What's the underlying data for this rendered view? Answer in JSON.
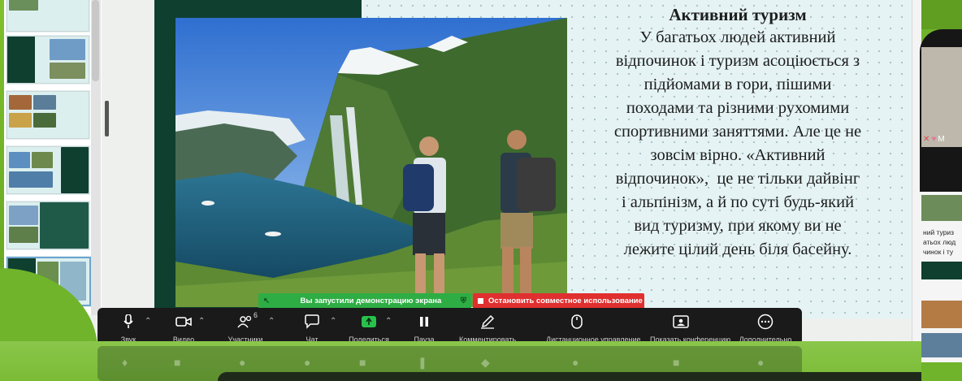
{
  "slide": {
    "title": "Активний туризм",
    "body_lines": [
      "У багатьох людей активний",
      "відпочинок і туризм асоціюється з",
      "підйомами в гори, пішими",
      "походами та різними рухомими",
      "спортивними заняттями. Але це не",
      "зовсім вірно. «Активний",
      "відпочинок»,  це не тільки дайвінг",
      "і альпінізм, а й по суті будь-який",
      "вид туризму, при якому ви не",
      "лежите цілий день біля басейну."
    ]
  },
  "banners": {
    "sharing": "Вы запустили демонстрацию экрана",
    "stop": "Остановить совместное использование"
  },
  "toolbar": {
    "sound": "Звук",
    "video": "Видео",
    "participants": "Участники",
    "participants_count": "6",
    "chat": "Чат",
    "share": "Поделиться",
    "pause": "Пауза",
    "annotate": "Комментировать",
    "remote_control": "Дистанционное управление",
    "show_conference": "Показать конференцию",
    "more": "Дополнительно"
  },
  "gallery": {
    "participant_label": "M",
    "preview_lines": [
      "ний туриз",
      "атьох люд",
      "чинок і ту"
    ]
  },
  "colors": {
    "slide_dark": "#0f3f2f",
    "slide_light": "#e5f3f4",
    "frame_green": "#6fb42a",
    "share_green": "#2ead44",
    "stop_red": "#e02f2f"
  },
  "icons": [
    "microphone-icon",
    "camera-icon",
    "participants-icon",
    "chat-icon",
    "share-screen-icon",
    "pause-icon",
    "pencil-icon",
    "mouse-icon",
    "show-conference-icon",
    "more-icon",
    "stop-icon",
    "shield-icon",
    "pointer-icon"
  ]
}
